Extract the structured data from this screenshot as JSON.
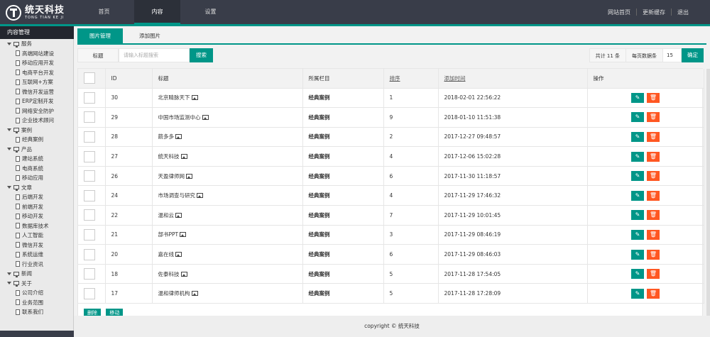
{
  "brand": {
    "name": "统天科技",
    "subtitle": "TONG TIAN KE JI"
  },
  "topnav": [
    {
      "label": "首页"
    },
    {
      "label": "内容"
    },
    {
      "label": "设置"
    }
  ],
  "topright": [
    {
      "label": "网站首页"
    },
    {
      "label": "更新缓存"
    },
    {
      "label": "退出"
    }
  ],
  "sidebar": {
    "title": "内容管理",
    "tree": [
      {
        "label": "服务",
        "level": 0
      },
      {
        "label": "高端网站建设",
        "level": 1
      },
      {
        "label": "移动应用开发",
        "level": 1
      },
      {
        "label": "电商平台开发",
        "level": 1
      },
      {
        "label": "互联网+方案",
        "level": 1
      },
      {
        "label": "微信开发运营",
        "level": 1
      },
      {
        "label": "ERP定制开发",
        "level": 1
      },
      {
        "label": "网络安全防护",
        "level": 1
      },
      {
        "label": "企业技术顾问",
        "level": 1
      },
      {
        "label": "案例",
        "level": 0
      },
      {
        "label": "经典案例",
        "level": 1
      },
      {
        "label": "产品",
        "level": 0
      },
      {
        "label": "建站系统",
        "level": 1
      },
      {
        "label": "电商系统",
        "level": 1
      },
      {
        "label": "移动应用",
        "level": 1
      },
      {
        "label": "文章",
        "level": 0
      },
      {
        "label": "后端开发",
        "level": 1
      },
      {
        "label": "前端开发",
        "level": 1
      },
      {
        "label": "移动开发",
        "level": 1
      },
      {
        "label": "数据库技术",
        "level": 1
      },
      {
        "label": "人工智能",
        "level": 1
      },
      {
        "label": "微信开发",
        "level": 1
      },
      {
        "label": "系统运维",
        "level": 1
      },
      {
        "label": "行业资讯",
        "level": 1
      },
      {
        "label": "新闻",
        "level": 0
      },
      {
        "label": "关于",
        "level": 0
      },
      {
        "label": "公司介绍",
        "level": 1
      },
      {
        "label": "业务范围",
        "level": 1
      },
      {
        "label": "联系我们",
        "level": 1
      }
    ]
  },
  "tabs": [
    {
      "label": "图片管理"
    },
    {
      "label": "添加图片"
    }
  ],
  "search": {
    "label": "标题",
    "placeholder": "请输入标题搜索",
    "button": "搜索"
  },
  "pager": {
    "total": "共计 11 条",
    "per_page_label": "每页数据条",
    "per_page_value": "15",
    "confirm": "确定"
  },
  "table": {
    "headers": {
      "id": "ID",
      "title": "标题",
      "category": "所属栏目",
      "sort": "排序",
      "time": "添加时间",
      "ops": "操作"
    },
    "rows": [
      {
        "id": "30",
        "title": "北京睛脉天下",
        "category": "经典案例",
        "sort": "1",
        "time": "2018-02-01 22:56:22"
      },
      {
        "id": "29",
        "title": "中国市场监测中心",
        "category": "经典案例",
        "sort": "9",
        "time": "2018-01-10 11:51:38"
      },
      {
        "id": "28",
        "title": "箭多多",
        "category": "经典案例",
        "sort": "2",
        "time": "2017-12-27 09:48:57"
      },
      {
        "id": "27",
        "title": "统天科技",
        "category": "经典案例",
        "sort": "4",
        "time": "2017-12-06 15:02:28"
      },
      {
        "id": "26",
        "title": "天盈律师网",
        "category": "经典案例",
        "sort": "6",
        "time": "2017-11-30 11:18:57"
      },
      {
        "id": "24",
        "title": "市场调查与研究",
        "category": "经典案例",
        "sort": "4",
        "time": "2017-11-29 17:46:32"
      },
      {
        "id": "22",
        "title": "温和云",
        "category": "经典案例",
        "sort": "7",
        "time": "2017-11-29 10:01:45"
      },
      {
        "id": "21",
        "title": "部书PPT",
        "category": "经典案例",
        "sort": "3",
        "time": "2017-11-29 08:46:19"
      },
      {
        "id": "20",
        "title": "嘉在线",
        "category": "经典案例",
        "sort": "6",
        "time": "2017-11-29 08:46:03"
      },
      {
        "id": "18",
        "title": "佐泰科技",
        "category": "经典案例",
        "sort": "5",
        "time": "2017-11-28 17:54:05"
      },
      {
        "id": "17",
        "title": "温和律师机构",
        "category": "经典案例",
        "sort": "5",
        "time": "2017-11-28 17:28:09"
      }
    ],
    "edit_glyph": "✎",
    "delete_glyph": "🗑",
    "bulk": {
      "delete": "删除",
      "move": "移动"
    }
  },
  "footer": {
    "text": "copyright ©  统天科技"
  },
  "colors": {
    "header": "#393d49",
    "accent": "#009688",
    "danger": "#ff5722"
  }
}
